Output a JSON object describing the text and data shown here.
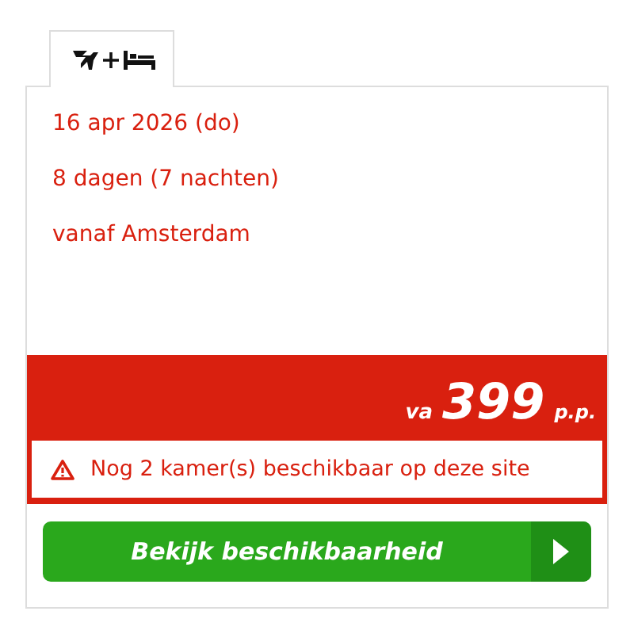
{
  "tabs": [
    {
      "selected": true
    }
  ],
  "details": [
    "16 apr 2026 (do)",
    "8 dagen (7 nachten)",
    "vanaf Amsterdam"
  ],
  "price": {
    "prefix": "va",
    "amount": "399",
    "suffix": "p.p."
  },
  "notice": "Nog 2 kamer(s) beschikbaar op deze site",
  "button": {
    "label": "Bekijk beschikbaarheid"
  }
}
